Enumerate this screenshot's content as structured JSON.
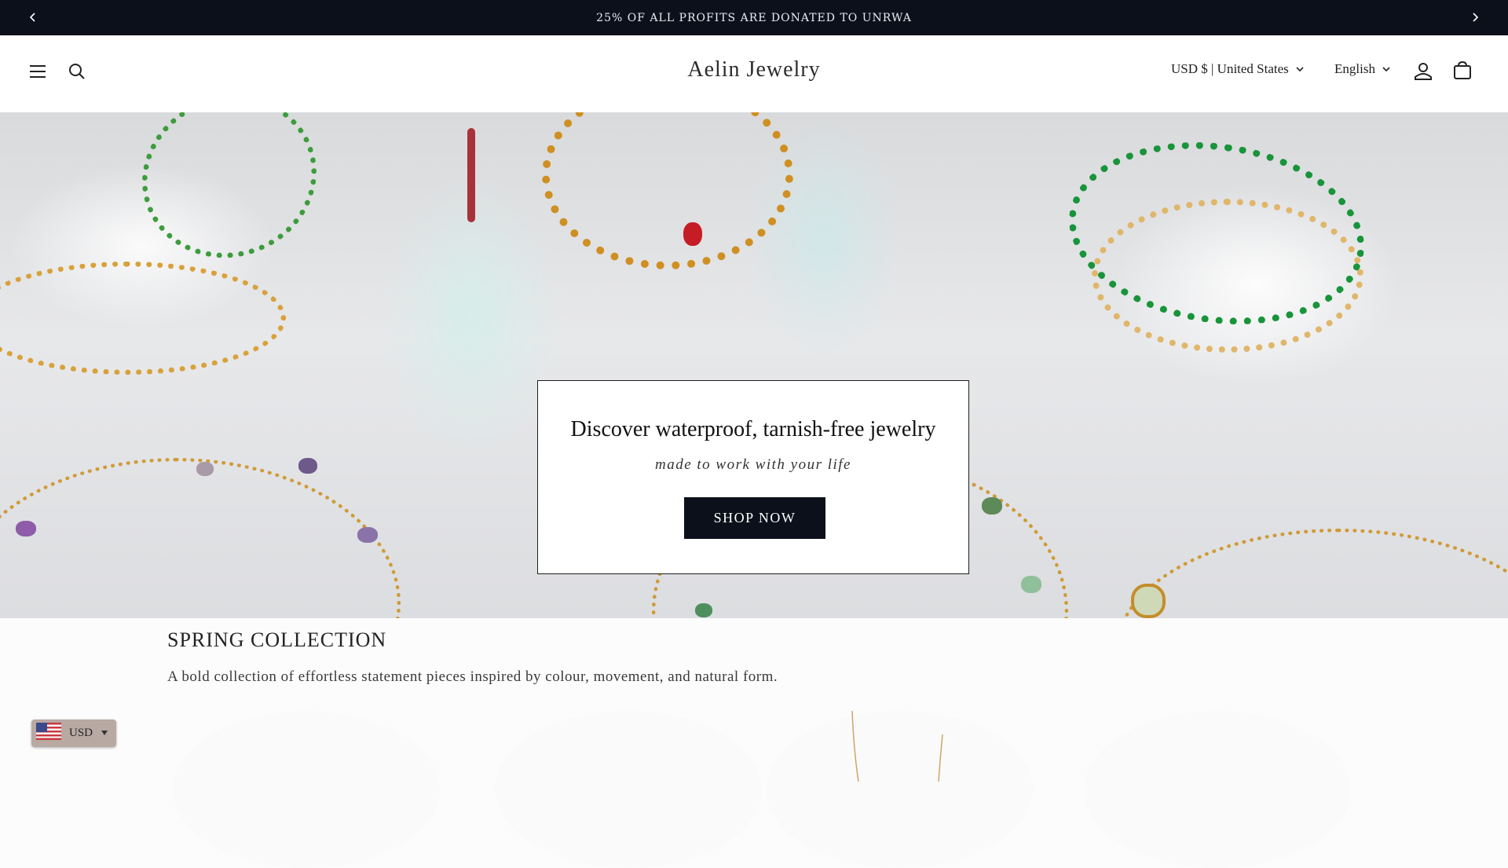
{
  "announcement": {
    "text": "25% OF ALL PROFITS ARE DONATED TO UNRWA",
    "prev_icon": "chevron-left-icon",
    "next_icon": "chevron-right-icon"
  },
  "header": {
    "brand": "Aelin Jewelry",
    "currency_selector": "USD $ | United States",
    "language_selector": "English",
    "icons": [
      "menu-icon",
      "search-icon",
      "account-icon",
      "cart-icon"
    ]
  },
  "hero": {
    "title": "Discover waterproof, tarnish-free jewelry",
    "subtitle": "made to work with your life",
    "cta_label": "SHOP NOW"
  },
  "collection": {
    "title": "SPRING COLLECTION",
    "description": "A bold collection of effortless statement pieces inspired by colour, movement, and natural form."
  },
  "currency_widget": {
    "code": "USD",
    "flag_icon": "us-flag-icon"
  },
  "colors": {
    "announcement_bg": "#0b101b",
    "button_bg": "#0b101b",
    "gold": "#d39a2a"
  }
}
